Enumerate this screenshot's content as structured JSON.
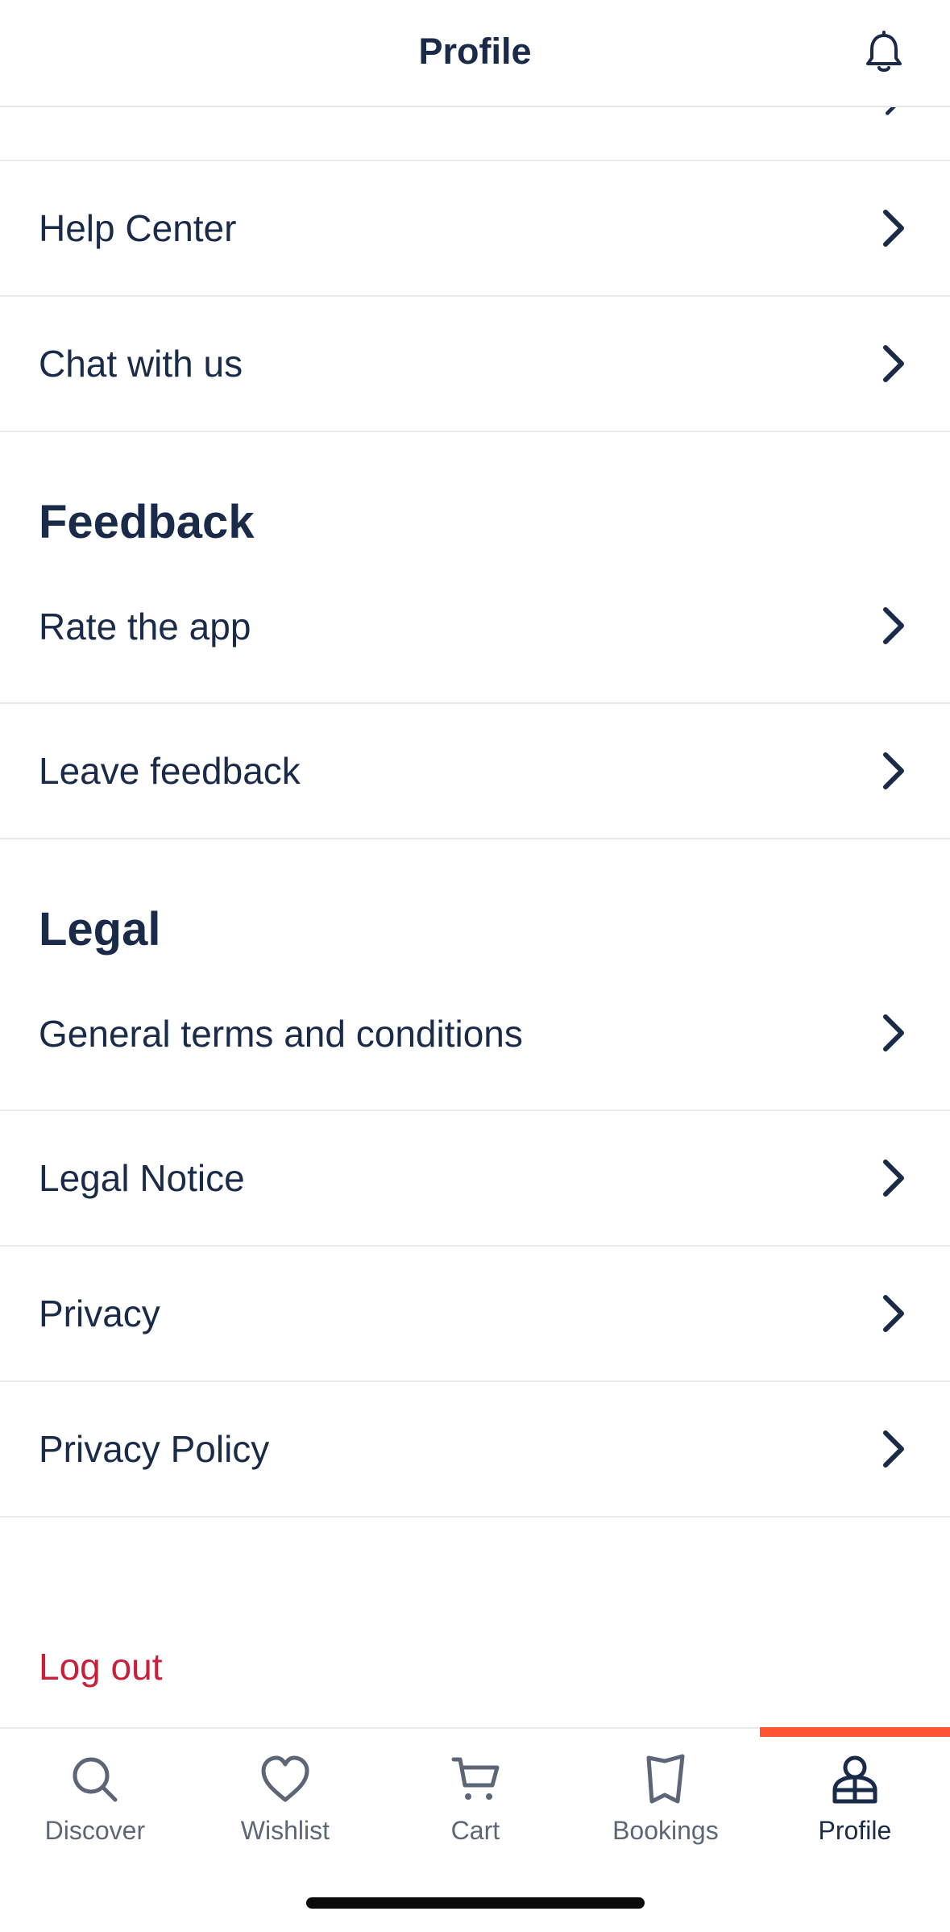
{
  "header": {
    "title": "Profile",
    "bell_icon": "bell-icon"
  },
  "support_items": [
    {
      "label": "Help Center"
    },
    {
      "label": "Chat with us"
    }
  ],
  "feedback": {
    "title": "Feedback",
    "items": [
      {
        "label": "Rate the app"
      },
      {
        "label": "Leave feedback"
      }
    ]
  },
  "legal": {
    "title": "Legal",
    "items": [
      {
        "label": "General terms and conditions"
      },
      {
        "label": "Legal Notice"
      },
      {
        "label": "Privacy"
      },
      {
        "label": "Privacy Policy"
      }
    ]
  },
  "logout_label": "Log out",
  "tabs": [
    {
      "label": "Discover",
      "icon": "search-icon",
      "active": false
    },
    {
      "label": "Wishlist",
      "icon": "heart-icon",
      "active": false
    },
    {
      "label": "Cart",
      "icon": "cart-icon",
      "active": false
    },
    {
      "label": "Bookings",
      "icon": "ticket-icon",
      "active": false
    },
    {
      "label": "Profile",
      "icon": "profile-icon",
      "active": true
    }
  ],
  "colors": {
    "text": "#1a2b49",
    "accent": "#ff5533",
    "logout": "#c8203b",
    "divider": "#e6e8ec"
  }
}
